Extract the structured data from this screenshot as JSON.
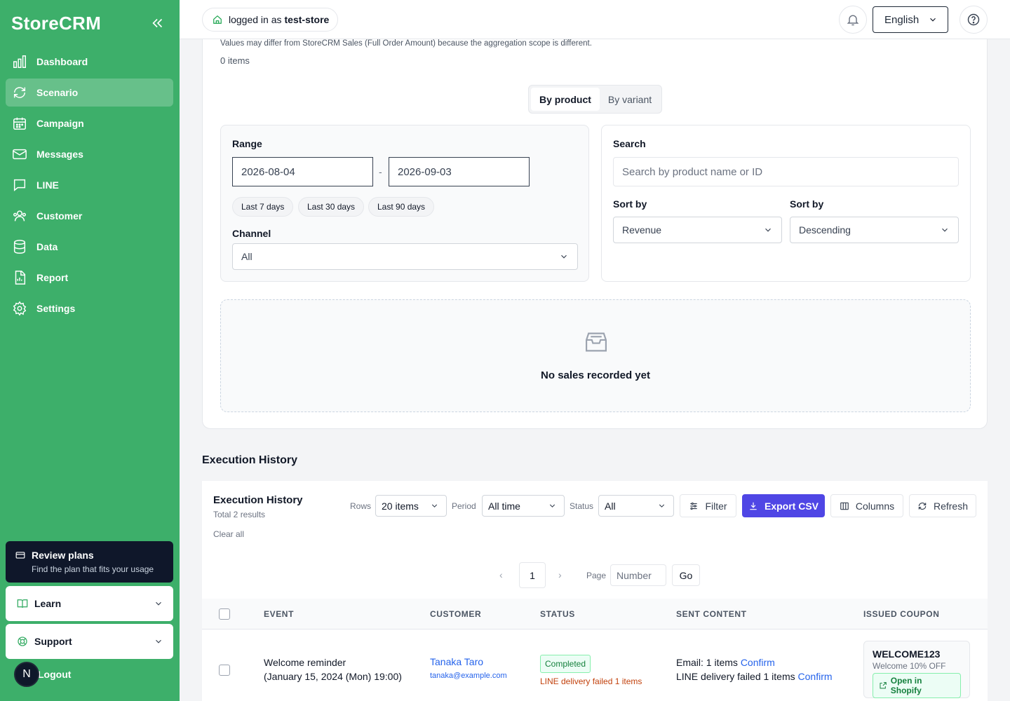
{
  "app": {
    "brand": "StoreCRM"
  },
  "sidebar": {
    "items": [
      {
        "label": "Dashboard",
        "icon": "bar-chart-icon"
      },
      {
        "label": "Scenario",
        "icon": "refresh-icon",
        "active": true
      },
      {
        "label": "Campaign",
        "icon": "calendar-icon"
      },
      {
        "label": "Messages",
        "icon": "mail-icon"
      },
      {
        "label": "LINE",
        "icon": "chat-icon"
      },
      {
        "label": "Customer",
        "icon": "users-icon"
      },
      {
        "label": "Data",
        "icon": "database-icon"
      },
      {
        "label": "Report",
        "icon": "report-icon"
      },
      {
        "label": "Settings",
        "icon": "gear-icon"
      }
    ],
    "plan": {
      "title": "Review plans",
      "subtitle": "Find the plan that fits your usage"
    },
    "learn": "Learn",
    "support": "Support",
    "avatar_initial": "N",
    "logout": "Logout"
  },
  "header": {
    "login_prefix": "logged in as",
    "store": "test-store",
    "language": "English"
  },
  "sales": {
    "note": "Values may differ from StoreCRM Sales (Full Order Amount) because the aggregation scope is different.",
    "count": "0 items",
    "toggle": {
      "product": "By product",
      "variant": "By variant"
    },
    "range_label": "Range",
    "date_from": "2026-08-04",
    "date_sep": "-",
    "date_to": "2026-09-03",
    "quick": [
      "Last 7 days",
      "Last 30 days",
      "Last 90 days"
    ],
    "channel_label": "Channel",
    "channel_value": "All",
    "search_label": "Search",
    "search_placeholder": "Search by product name or ID",
    "sort_label_1": "Sort by",
    "sort_value_1": "Revenue",
    "sort_label_2": "Sort by",
    "sort_value_2": "Descending",
    "empty_message": "No sales recorded yet"
  },
  "history": {
    "section_title": "Execution History",
    "title": "Execution History",
    "subtitle": "Total 2 results",
    "clear_all": "Clear all",
    "rows_label": "Rows",
    "rows_value": "20 items",
    "period_label": "Period",
    "period_value": "All time",
    "status_label": "Status",
    "status_value": "All",
    "filter": "Filter",
    "export": "Export CSV",
    "columns": "Columns",
    "refresh": "Refresh",
    "page_current": "1",
    "page_label": "Page",
    "page_placeholder": "Number",
    "go": "Go",
    "columns_headers": [
      "EVENT",
      "CUSTOMER",
      "STATUS",
      "SENT CONTENT",
      "ISSUED COUPON"
    ],
    "rows": [
      {
        "event": "Welcome reminder",
        "event_time": "(January 15, 2024 (Mon) 19:00)",
        "customer_name": "Tanaka Taro",
        "customer_email": "tanaka@example.com",
        "status": "Completed",
        "status_note": "LINE delivery failed 1 items",
        "sent_line1": "Email: 1 items",
        "sent_line2": "LINE delivery failed 1 items",
        "confirm": "Confirm",
        "coupon_code": "WELCOME123",
        "coupon_desc": "Welcome 10% OFF",
        "coupon_action": "Open in Shopify"
      }
    ]
  },
  "colors": {
    "sidebar": "#3daf6a",
    "primary": "#4f46e5",
    "success": "#15803d",
    "warning": "#c2410c",
    "link": "#2563eb"
  }
}
